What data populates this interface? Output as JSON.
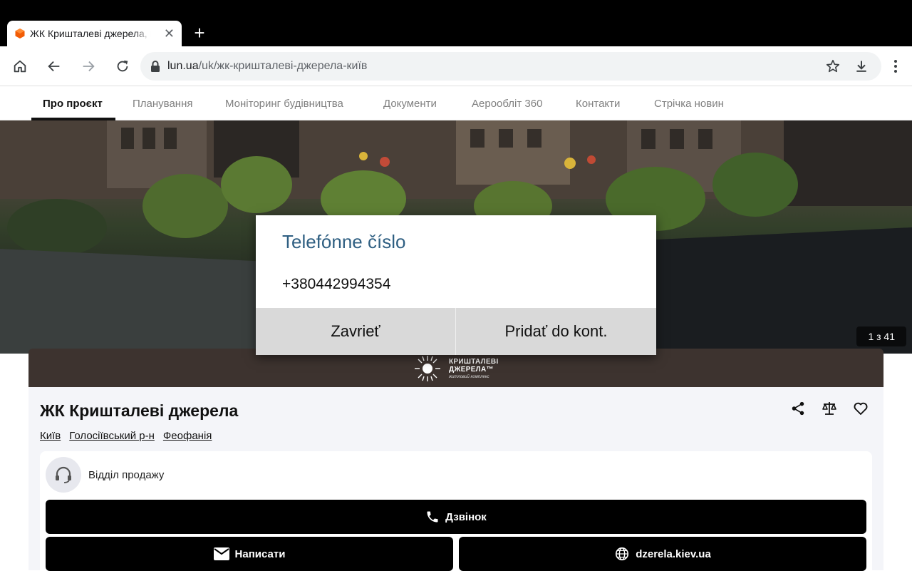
{
  "browser": {
    "tab_title": "ЖК Кришталеві джерела, К",
    "url_host": "lun.ua",
    "url_path": "/uk/жк-кришталеві-джерела-київ"
  },
  "page_nav": {
    "items": [
      "Про проєкт",
      "Планування",
      "Моніторинг будівництва",
      "Документи",
      "Аерообліт 360",
      "Контакти",
      "Стрічка новин"
    ]
  },
  "hero": {
    "counter": "1 з 41"
  },
  "brand": {
    "name_line1": "КРИШТАЛЕВІ",
    "name_line2": "ДЖЕРЕЛА™",
    "sub": "житловий комплекс"
  },
  "listing": {
    "title": "ЖК Кришталеві джерела",
    "locations": [
      "Київ",
      "Голосіївський р-н",
      "Феофанія"
    ],
    "agent": "Відділ продажу",
    "call_label": "Дзвінок",
    "write_label": "Написати",
    "site_label": "dzerela.kiev.ua"
  },
  "dialog": {
    "title": "Telefónne číslo",
    "number": "+380442994354",
    "close_label": "Zavrieť",
    "add_label": "Pridať do kont."
  }
}
